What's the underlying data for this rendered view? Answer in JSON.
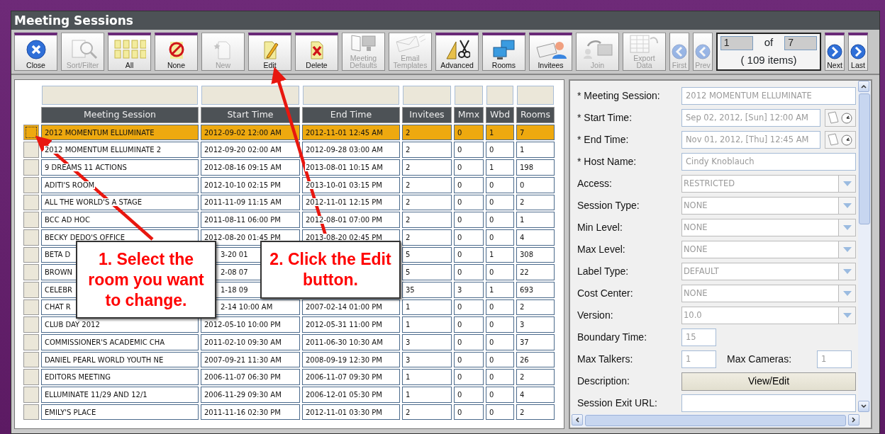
{
  "window": {
    "title": "Meeting Sessions"
  },
  "toolbar": [
    {
      "label": "Close",
      "disabled": false
    },
    {
      "label": "Sort/Filter",
      "disabled": true
    },
    {
      "label": "All",
      "disabled": false
    },
    {
      "label": "None",
      "disabled": false
    },
    {
      "label": "New",
      "disabled": true
    },
    {
      "label": "Edit",
      "disabled": false
    },
    {
      "label": "Delete",
      "disabled": false
    },
    {
      "label": "Meeting Defaults",
      "disabled": true
    },
    {
      "label": "Email Templates",
      "disabled": true
    },
    {
      "label": "Advanced",
      "disabled": false
    },
    {
      "label": "Rooms",
      "disabled": false
    },
    {
      "label": "Invitees",
      "disabled": false
    },
    {
      "label": "Join",
      "disabled": true
    },
    {
      "label": "Export Data",
      "disabled": true
    },
    {
      "label": "First",
      "disabled": true
    },
    {
      "label": "Prev",
      "disabled": true
    }
  ],
  "pager": {
    "page": "1",
    "of": "of",
    "pages": "7",
    "count": "( 109 items)"
  },
  "pager_buttons": [
    {
      "label": "Next",
      "disabled": false
    },
    {
      "label": "Last",
      "disabled": false
    }
  ],
  "table": {
    "columns": [
      "Meeting Session",
      "Start Time",
      "End Time",
      "Invitees",
      "Mmx",
      "Wbd",
      "Rooms"
    ],
    "rows": [
      {
        "selected": true,
        "cells": [
          "2012 MOMENTUM ELLUMINATE",
          "2012-09-02 12:00 AM",
          "2012-11-01 12:45 AM",
          "2",
          "0",
          "1",
          "7"
        ]
      },
      {
        "selected": false,
        "cells": [
          "2012 MOMENTUM ELLUMINATE 2",
          "2012-09-20 02:00 AM",
          "2012-09-28 03:00 AM",
          "2",
          "0",
          "0",
          "1"
        ]
      },
      {
        "selected": false,
        "cells": [
          "9 DREAMS 11 ACTIONS",
          "2012-08-16 09:15 AM",
          "2013-08-01 10:15 AM",
          "2",
          "0",
          "1",
          "198"
        ]
      },
      {
        "selected": false,
        "cells": [
          "ADITI'S ROOM",
          "2012-10-10 02:15 PM",
          "2013-10-01 03:15 PM",
          "2",
          "0",
          "0",
          "0"
        ]
      },
      {
        "selected": false,
        "cells": [
          "ALL THE WORLD'S A STAGE",
          "2011-11-09 11:15 AM",
          "2012-11-01 12:15 PM",
          "2",
          "0",
          "0",
          "2"
        ]
      },
      {
        "selected": false,
        "cells": [
          "BCC AD HOC",
          "2011-08-11 06:00 PM",
          "2012-08-01 07:00 PM",
          "2",
          "0",
          "0",
          "1"
        ]
      },
      {
        "selected": false,
        "cells": [
          "BECKY DEDO'S OFFICE",
          "2012-08-20 01:45 PM",
          "2013-08-20 02:45 PM",
          "2",
          "0",
          "0",
          "4"
        ]
      },
      {
        "selected": false,
        "cells": [
          "BETA D",
          {
            "text": "3-20 01",
            "cut_left": true
          },
          null,
          "5",
          "0",
          "1",
          "308"
        ]
      },
      {
        "selected": false,
        "cells": [
          "BROWN",
          {
            "text": "2-08 07",
            "cut_left": true
          },
          null,
          "5",
          "0",
          "0",
          "22"
        ]
      },
      {
        "selected": false,
        "cells": [
          "CELEBR",
          {
            "text": "1-18 09",
            "cut_left": true
          },
          null,
          "35",
          "3",
          "1",
          "693"
        ]
      },
      {
        "selected": false,
        "cells": [
          "CHAT R",
          {
            "text": "2-14 10:00 AM",
            "cut_left": true
          },
          "2007-02-14 01:00 PM",
          "1",
          "0",
          "0",
          "2"
        ]
      },
      {
        "selected": false,
        "cells": [
          "CLUB DAY 2012",
          "2012-05-10 10:00 PM",
          "2012-05-31 11:00 PM",
          "1",
          "0",
          "0",
          "3"
        ]
      },
      {
        "selected": false,
        "cells": [
          "COMMISSIONER'S ACADEMIC CHA",
          "2011-02-10 09:30 AM",
          "2011-06-30 10:30 AM",
          "3",
          "0",
          "0",
          "37"
        ]
      },
      {
        "selected": false,
        "cells": [
          "DANIEL PEARL WORLD YOUTH NE",
          "2007-09-21 11:30 AM",
          "2008-09-19 12:30 PM",
          "3",
          "0",
          "0",
          "26"
        ]
      },
      {
        "selected": false,
        "cells": [
          "EDITORS MEETING",
          "2006-11-07 06:30 PM",
          "2006-11-07 09:30 PM",
          "1",
          "0",
          "0",
          "2"
        ]
      },
      {
        "selected": false,
        "cells": [
          "ELLUMINATE 11/29 AND 12/1",
          "2006-11-29 09:30 AM",
          "2006-12-01 05:30 PM",
          "1",
          "0",
          "0",
          "4"
        ]
      },
      {
        "selected": false,
        "cells": [
          "EMILY'S PLACE",
          "2011-11-16 02:30 PM",
          "2012-11-01 03:30 PM",
          "2",
          "0",
          "0",
          "2"
        ]
      }
    ]
  },
  "form": [
    {
      "kind": "text",
      "label": "* Meeting Session:",
      "value": "2012 MOMENTUM ELLUMINATE"
    },
    {
      "kind": "datetime",
      "label": "* Start Time:",
      "value": "Sep 02, 2012, [Sun] 12:00 AM"
    },
    {
      "kind": "datetime",
      "label": "* End Time:",
      "value": "Nov 01, 2012, [Thu] 12:45 AM"
    },
    {
      "kind": "text",
      "label": "* Host Name:",
      "value": "Cindy Knoblauch"
    },
    {
      "kind": "select",
      "label": "Access:",
      "value": "RESTRICTED"
    },
    {
      "kind": "select",
      "label": "Session Type:",
      "value": "NONE"
    },
    {
      "kind": "select",
      "label": "Min Level:",
      "value": "NONE"
    },
    {
      "kind": "select",
      "label": "Max Level:",
      "value": "NONE"
    },
    {
      "kind": "select",
      "label": "Label Type:",
      "value": "DEFAULT"
    },
    {
      "kind": "select",
      "label": "Cost Center:",
      "value": "NONE"
    },
    {
      "kind": "select",
      "label": "Version:",
      "value": "10.0"
    },
    {
      "kind": "short",
      "label": "Boundary Time:",
      "value": "15"
    },
    {
      "kind": "pair",
      "label": "Max Talkers:",
      "value": "1",
      "label_2": "Max Cameras:",
      "value_2": "1"
    },
    {
      "kind": "button",
      "label": "Description:",
      "button": "View/Edit"
    },
    {
      "kind": "text",
      "label": "Session Exit URL:"
    }
  ],
  "callouts": [
    "1. Select the room you want to change.",
    "2. Click the Edit button."
  ]
}
